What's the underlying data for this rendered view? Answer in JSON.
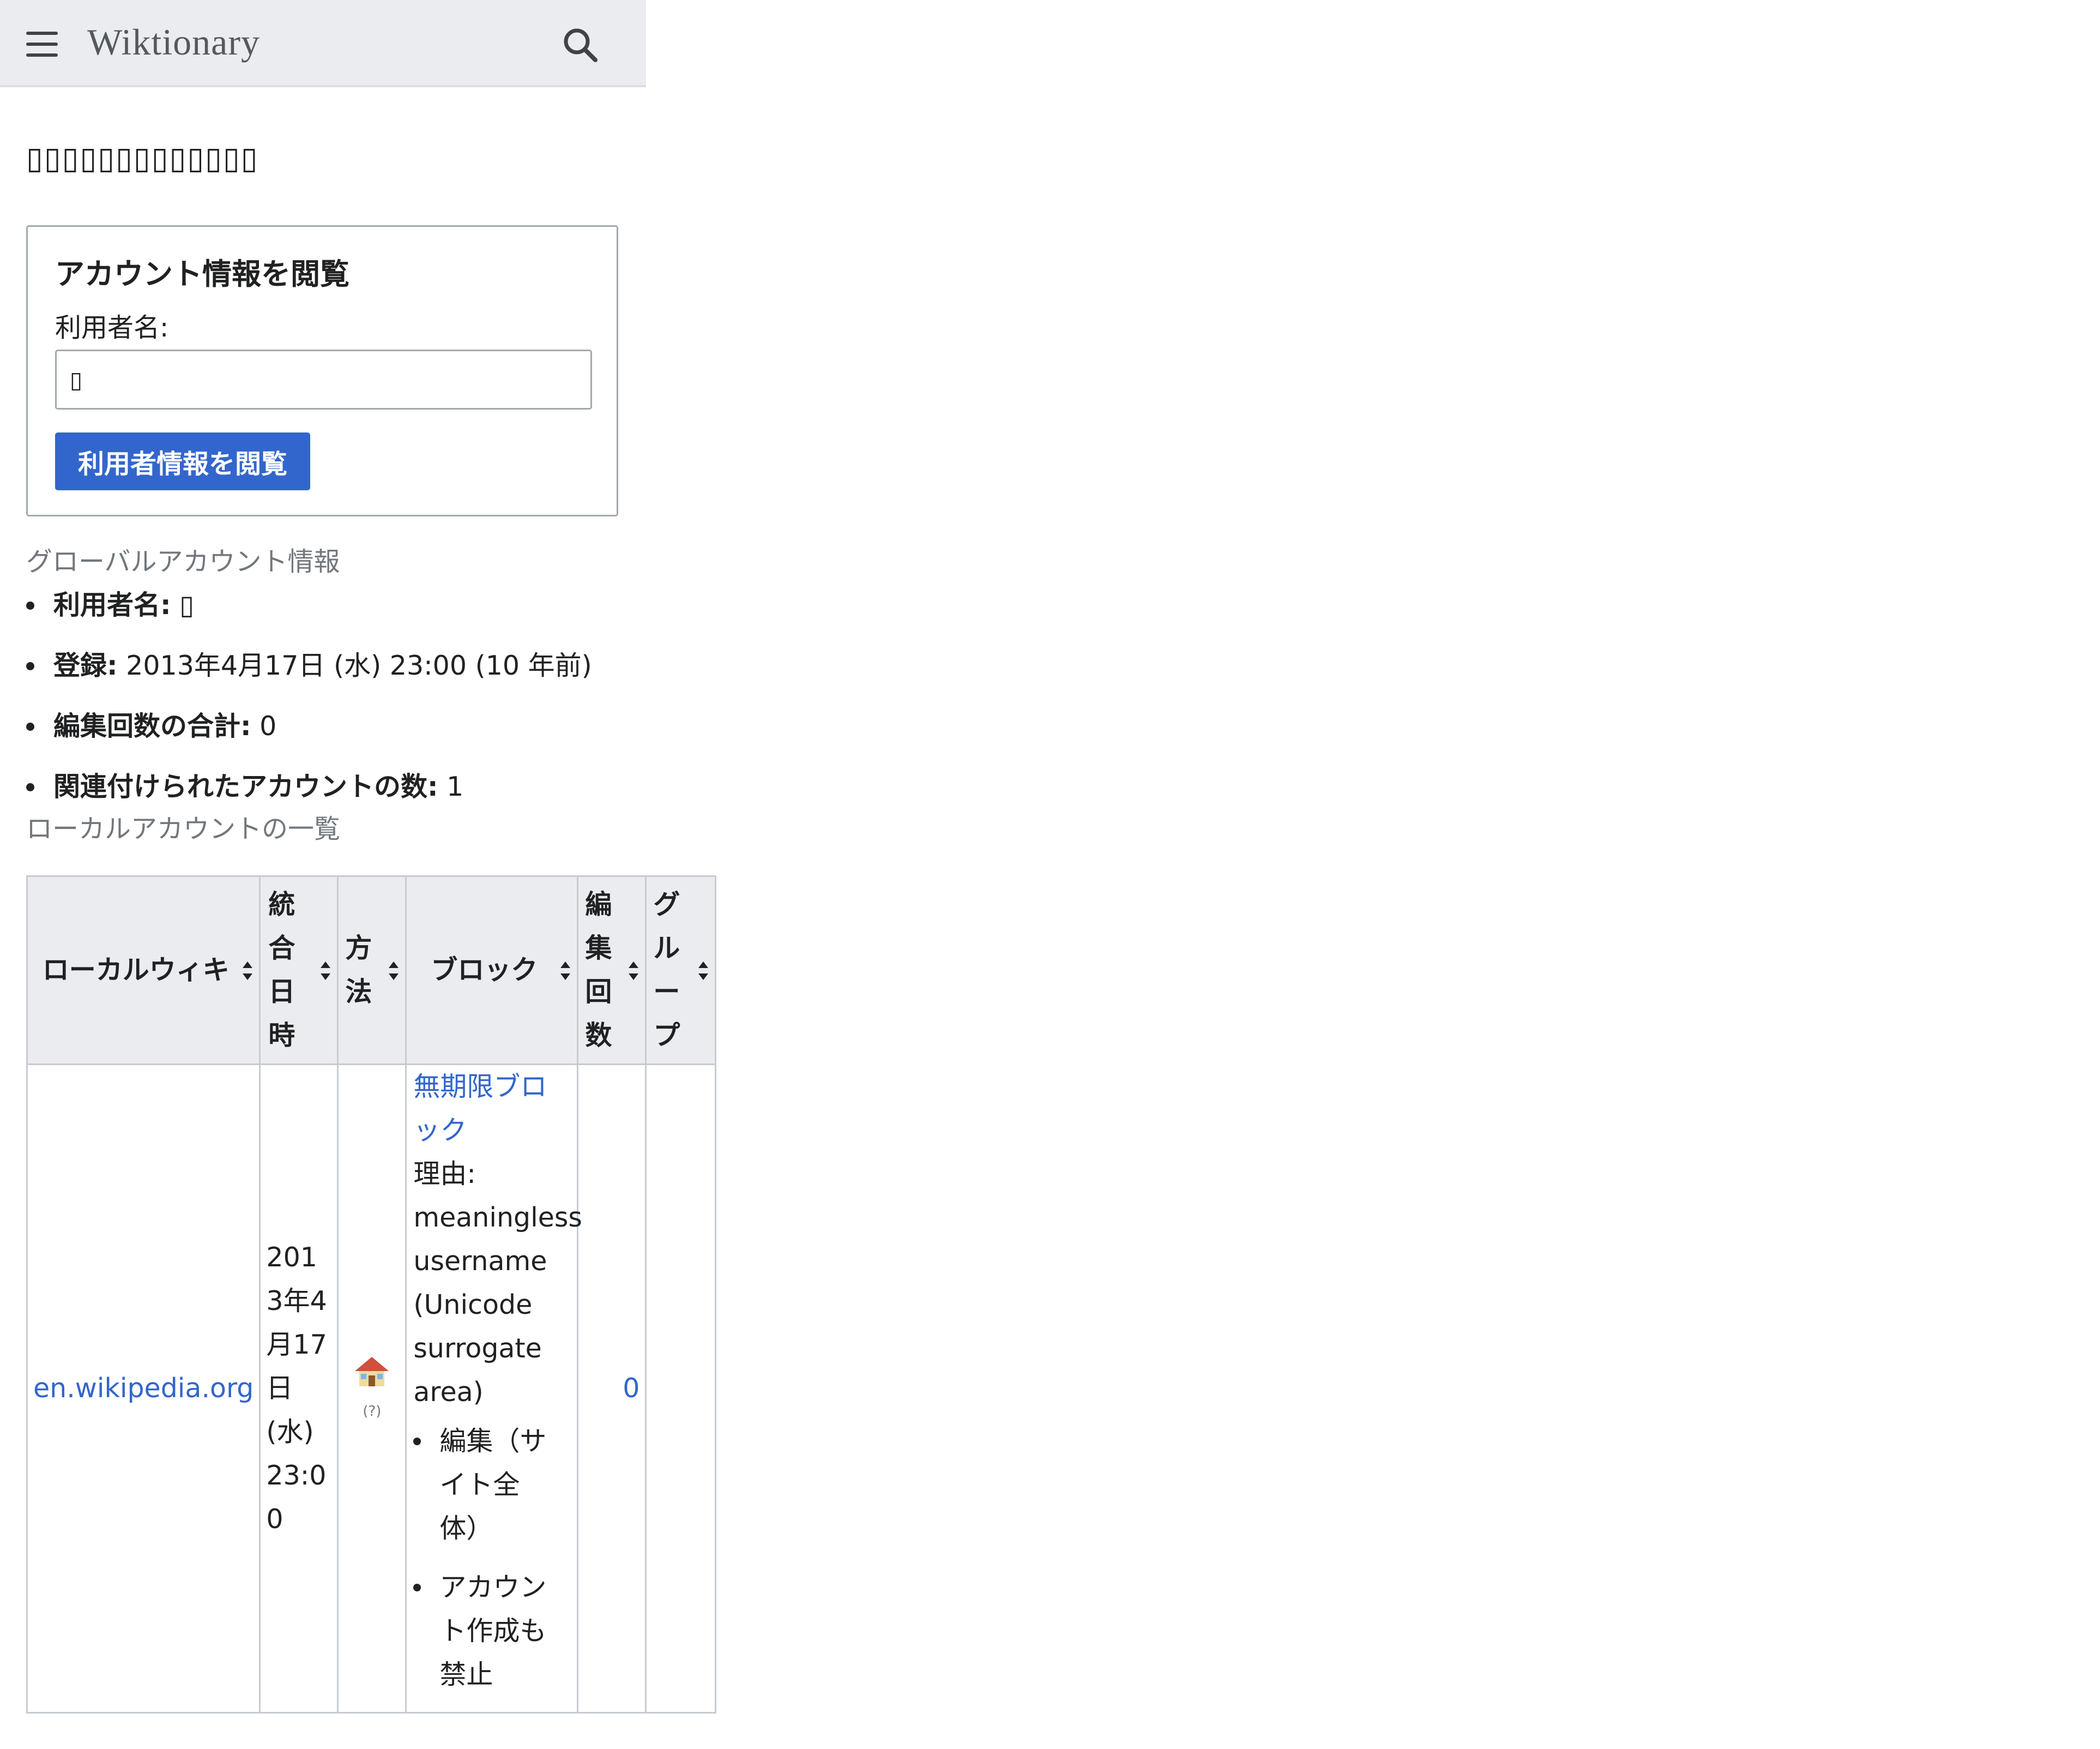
{
  "header": {
    "logo": "Wiktionary",
    "menu_icon": "hamburger-menu-icon",
    "search_icon": "search-icon"
  },
  "page_title": "▯▯▯▯▯▯▯▯▯▯▯▯▯",
  "form": {
    "legend": "アカウント情報を閲覧",
    "username_label": "利用者名:",
    "username_value": "▯",
    "submit_label": "利用者情報を閲覧"
  },
  "global_info": {
    "caption": "グローバルアカウント情報",
    "items": [
      {
        "label": "利用者名:",
        "value": " ▯"
      },
      {
        "label": "登録:",
        "value": " 2013年4月17日 (水) 23:00 (10 年前)"
      },
      {
        "label": "編集回数の合計:",
        "value": " 0"
      },
      {
        "label": "関連付けられたアカウントの数:",
        "value": " 1"
      }
    ]
  },
  "local_accounts": {
    "caption": "ローカルアカウントの一覧",
    "headers": [
      "ローカルウィキ",
      "統合日時",
      "方法",
      "ブロック",
      "編集回数",
      "グループ"
    ],
    "rows": [
      {
        "wiki": "en.wikipedia.org",
        "merged": "2013年4月17日 (水) 23:00",
        "method_icon": "home-icon",
        "method_help": "(?)",
        "block_link": "無期限ブロック",
        "block_reason": "理由: meaningless username (Unicode surrogate area)",
        "block_items": [
          "編集（サイト全体）",
          "アカウント作成も禁止"
        ],
        "edit_count": "0",
        "groups": ""
      }
    ]
  },
  "colors": {
    "link": "#3366cc",
    "header_bg": "#eaecf0",
    "button_bg": "#3366cc",
    "caption": "#72777d"
  }
}
